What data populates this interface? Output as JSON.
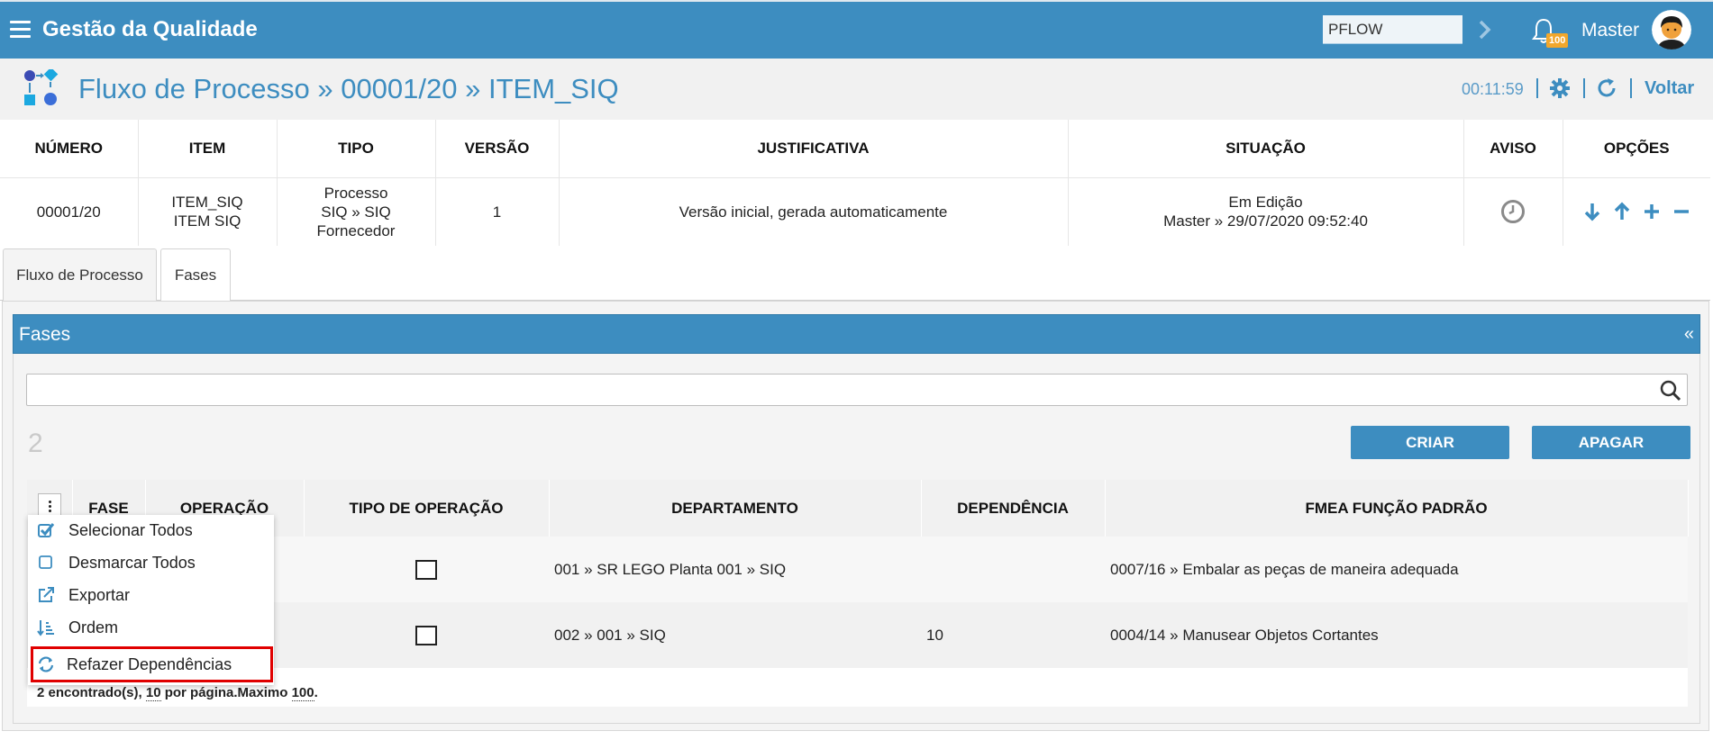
{
  "topbar": {
    "app_title": "Gestão da Qualidade",
    "pflow_value": "PFLOW",
    "notification_count": "100",
    "user_name": "Master"
  },
  "header": {
    "title": "Fluxo de Processo » 00001/20 » ITEM_SIQ",
    "timer": "00:11:59",
    "voltar_label": "Voltar"
  },
  "info": {
    "columns": [
      "NÚMERO",
      "ITEM",
      "TIPO",
      "VERSÃO",
      "JUSTIFICATIVA",
      "SITUAÇÃO",
      "AVISO",
      "OPÇÕES"
    ],
    "row": {
      "numero": "00001/20",
      "item_line1": "ITEM_SIQ",
      "item_line2": "ITEM SIQ",
      "tipo_line1": "Processo",
      "tipo_line2": "SIQ » SIQ",
      "tipo_line3": "Fornecedor",
      "versao": "1",
      "justificativa": "Versão inicial, gerada automaticamente",
      "situacao_line1": "Em Edição",
      "situacao_line2": "Master » 29/07/2020 09:52:40"
    }
  },
  "tabs": [
    {
      "label": "Fluxo de Processo",
      "active": false
    },
    {
      "label": "Fases",
      "active": true
    }
  ],
  "panel": {
    "title": "Fases",
    "collapse_label": "«",
    "count": "2",
    "criar_label": "CRIAR",
    "apagar_label": "APAGAR"
  },
  "grid": {
    "columns": [
      "FASE",
      "OPERAÇÃO",
      "TIPO DE OPERAÇÃO",
      "DEPARTAMENTO",
      "DEPENDÊNCIA",
      "FMEA FUNÇÃO PADRÃO"
    ],
    "rows": [
      {
        "departamento": "001 » SR LEGO Planta 001 » SIQ",
        "dependencia": "",
        "fmea": "0007/16 » Embalar as peças de maneira adequada"
      },
      {
        "departamento": "002 » 001 » SIQ",
        "dependencia": "10",
        "fmea": "0004/14 » Manusear Objetos Cortantes"
      }
    ]
  },
  "menu": {
    "items": [
      {
        "label": "Selecionar Todos",
        "icon": "check-square-icon"
      },
      {
        "label": "Desmarcar Todos",
        "icon": "square-icon"
      },
      {
        "label": "Exportar",
        "icon": "external-link-icon"
      },
      {
        "label": "Ordem",
        "icon": "sort-order-icon"
      },
      {
        "label": "Refazer Dependências",
        "icon": "sync-icon"
      }
    ]
  },
  "footer": {
    "prefix": "2 encontrado(s),",
    "per_page": "10",
    "per_page_suffix": "por página.Maximo",
    "max": "100",
    "end": "."
  },
  "colors": {
    "primary": "#3d8dc0",
    "badge": "#f1a72c",
    "highlight": "#e00000"
  }
}
